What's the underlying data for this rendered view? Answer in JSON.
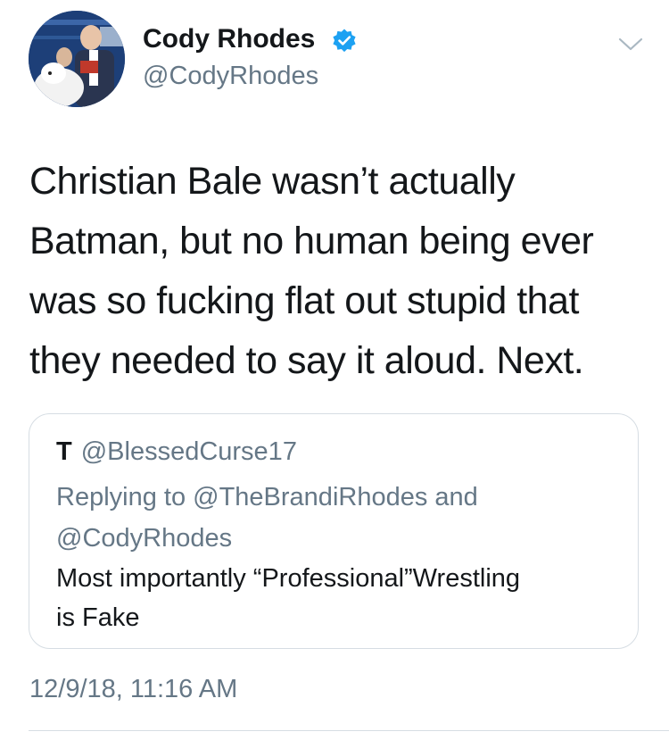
{
  "author": {
    "display_name": "Cody Rhodes",
    "handle": "@CodyRhodes",
    "verified_icon": "verified-badge-icon",
    "avatar": "profile-photo"
  },
  "menu_icon": "chevron-down-icon",
  "tweet": {
    "text_lines": [
      "Christian Bale wasn’t actually",
      "Batman, but no human being ever",
      "was so fucking flat out stupid that",
      "they needed to say it aloud. Next."
    ],
    "timestamp": "12/9/18, 11:16 AM"
  },
  "quoted_tweet": {
    "author_name": "T",
    "author_handle": "@BlessedCurse17",
    "reply_lines": [
      "Replying to @TheBrandiRhodes and",
      "@CodyRhodes"
    ],
    "text_lines": [
      "Most importantly “Professional”Wrestling",
      "is Fake"
    ]
  },
  "colors": {
    "text_primary": "#14171a",
    "text_secondary": "#657786",
    "verified_blue": "#1da1f2",
    "border": "#d6dde3"
  }
}
